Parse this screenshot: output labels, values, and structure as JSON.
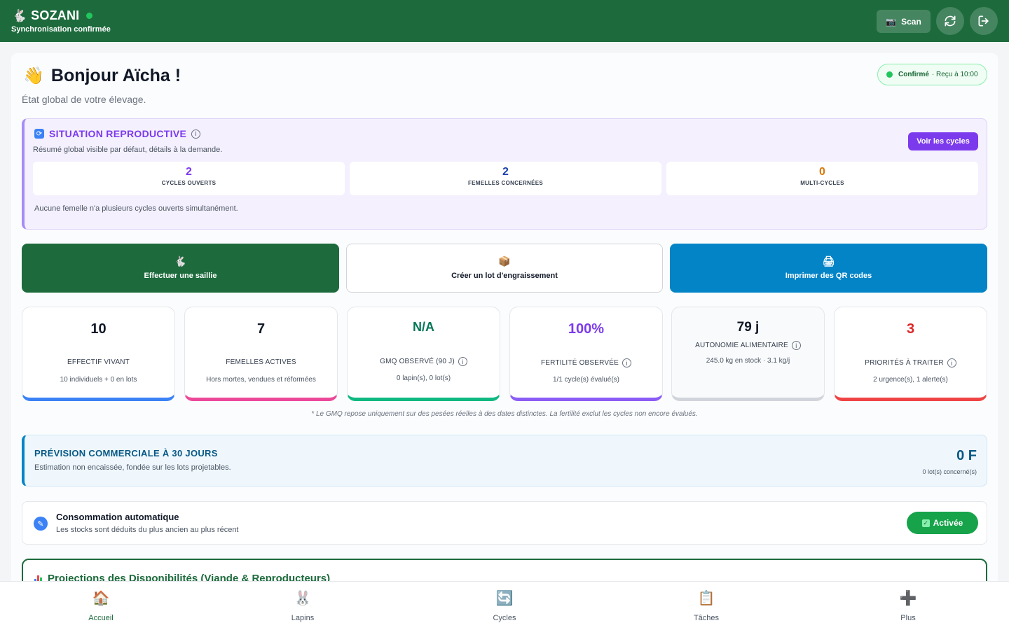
{
  "header": {
    "brand": "SOZANI",
    "sync_status": "Synchronisation confirmée",
    "scan_label": "Scan"
  },
  "greeting": {
    "title": "Bonjour Aïcha !",
    "subtitle": "État global de votre élevage.",
    "icon": "👋"
  },
  "status_pill": {
    "confirmed": "Confirmé",
    "received": "· Reçu à 10:00"
  },
  "repro": {
    "title": "SITUATION REPRODUCTIVE",
    "subtitle": "Résumé global visible par défaut, détails à la demande.",
    "button": "Voir les cycles",
    "stats": [
      {
        "value": "2",
        "label": "CYCLES OUVERTS",
        "color": "#7c3aed"
      },
      {
        "value": "2",
        "label": "FEMELLES CONCERNÉES",
        "color": "#1e40af"
      },
      {
        "value": "0",
        "label": "MULTI-CYCLES",
        "color": "#d97706"
      }
    ],
    "note": "Aucune femelle n'a plusieurs cycles ouverts simultanément."
  },
  "actions": [
    {
      "label": "Effectuer une saillie",
      "icon": "🐇"
    },
    {
      "label": "Créer un lot d'engraissement",
      "icon": "📦"
    },
    {
      "label": "Imprimer des QR codes",
      "icon": "🖨"
    }
  ],
  "kpis": [
    {
      "value": "10",
      "label": "EFFECTIF VIVANT",
      "detail": "10 individuels + 0 en lots",
      "color": "#111827",
      "accent": "#3b82f6"
    },
    {
      "value": "7",
      "label": "FEMELLES ACTIVES",
      "detail": "Hors mortes, vendues et réformées",
      "color": "#111827",
      "accent": "#ec4899"
    },
    {
      "value": "N/A",
      "label": "GMQ OBSERVÉ (90 J)",
      "detail": "0 lapin(s), 0 lot(s)",
      "color": "#047857",
      "accent": "#10b981"
    },
    {
      "value": "100%",
      "label": "FERTILITÉ OBSERVÉE",
      "detail": "1/1 cycle(s) évalué(s)",
      "color": "#7c3aed",
      "accent": "#8b5cf6"
    },
    {
      "value": "79 j",
      "label": "AUTONOMIE ALIMENTAIRE",
      "detail": "245.0 kg en stock · 3.1 kg/j",
      "color": "#111827",
      "accent": "#d1d5db"
    },
    {
      "value": "3",
      "label": "PRIORITÉS À TRAITER",
      "detail": "2 urgence(s), 1 alerte(s)",
      "color": "#dc2626",
      "accent": "#ef4444"
    }
  ],
  "footnote": "* Le GMQ repose uniquement sur des pesées réelles à des dates distinctes. La fertilité exclut les cycles non encore évalués.",
  "forecast": {
    "title": "PRÉVISION COMMERCIALE À 30 JOURS",
    "subtitle": "Estimation non encaissée, fondée sur les lots projetables.",
    "value": "0 F",
    "detail": "0 lot(s) concerné(s)"
  },
  "conso": {
    "title": "Consommation automatique",
    "subtitle": "Les stocks sont déduits du plus ancien au plus récent",
    "toggle": "Activée"
  },
  "projections": {
    "title": "Projections des Disponibilités (Viande & Reproducteurs)"
  },
  "nav": [
    {
      "label": "Accueil",
      "icon": "🏠"
    },
    {
      "label": "Lapins",
      "icon": "🐰"
    },
    {
      "label": "Cycles",
      "icon": "🔄"
    },
    {
      "label": "Tâches",
      "icon": "📋"
    },
    {
      "label": "Plus",
      "icon": "➕"
    }
  ]
}
